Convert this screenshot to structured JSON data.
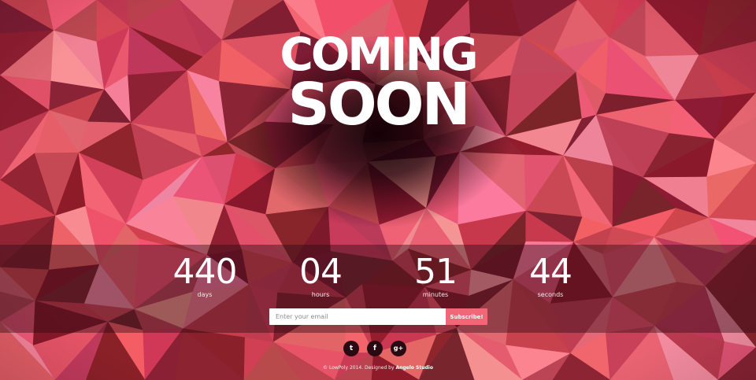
{
  "logo": {
    "line1": "COMING",
    "line2": "SOON"
  },
  "countdown": [
    {
      "value": "440",
      "unit": "days"
    },
    {
      "value": "04",
      "unit": "hours"
    },
    {
      "value": "51",
      "unit": "minutes"
    },
    {
      "value": "44",
      "unit": "seconds"
    }
  ],
  "subscribe_form": {
    "email_placeholder": "Enter your email",
    "button_label": "Subscribe!"
  },
  "social": [
    {
      "name": "twitter",
      "glyph": "t"
    },
    {
      "name": "facebook",
      "glyph": "f"
    },
    {
      "name": "google-plus",
      "glyph": "g+"
    }
  ],
  "footer": {
    "prefix": "© LowPoly 2014. Designed by ",
    "studio": "Angelo Studio"
  },
  "colors": {
    "accent": "#f06878",
    "background_pink": "#e0546a",
    "dark": "#2a0a12"
  }
}
